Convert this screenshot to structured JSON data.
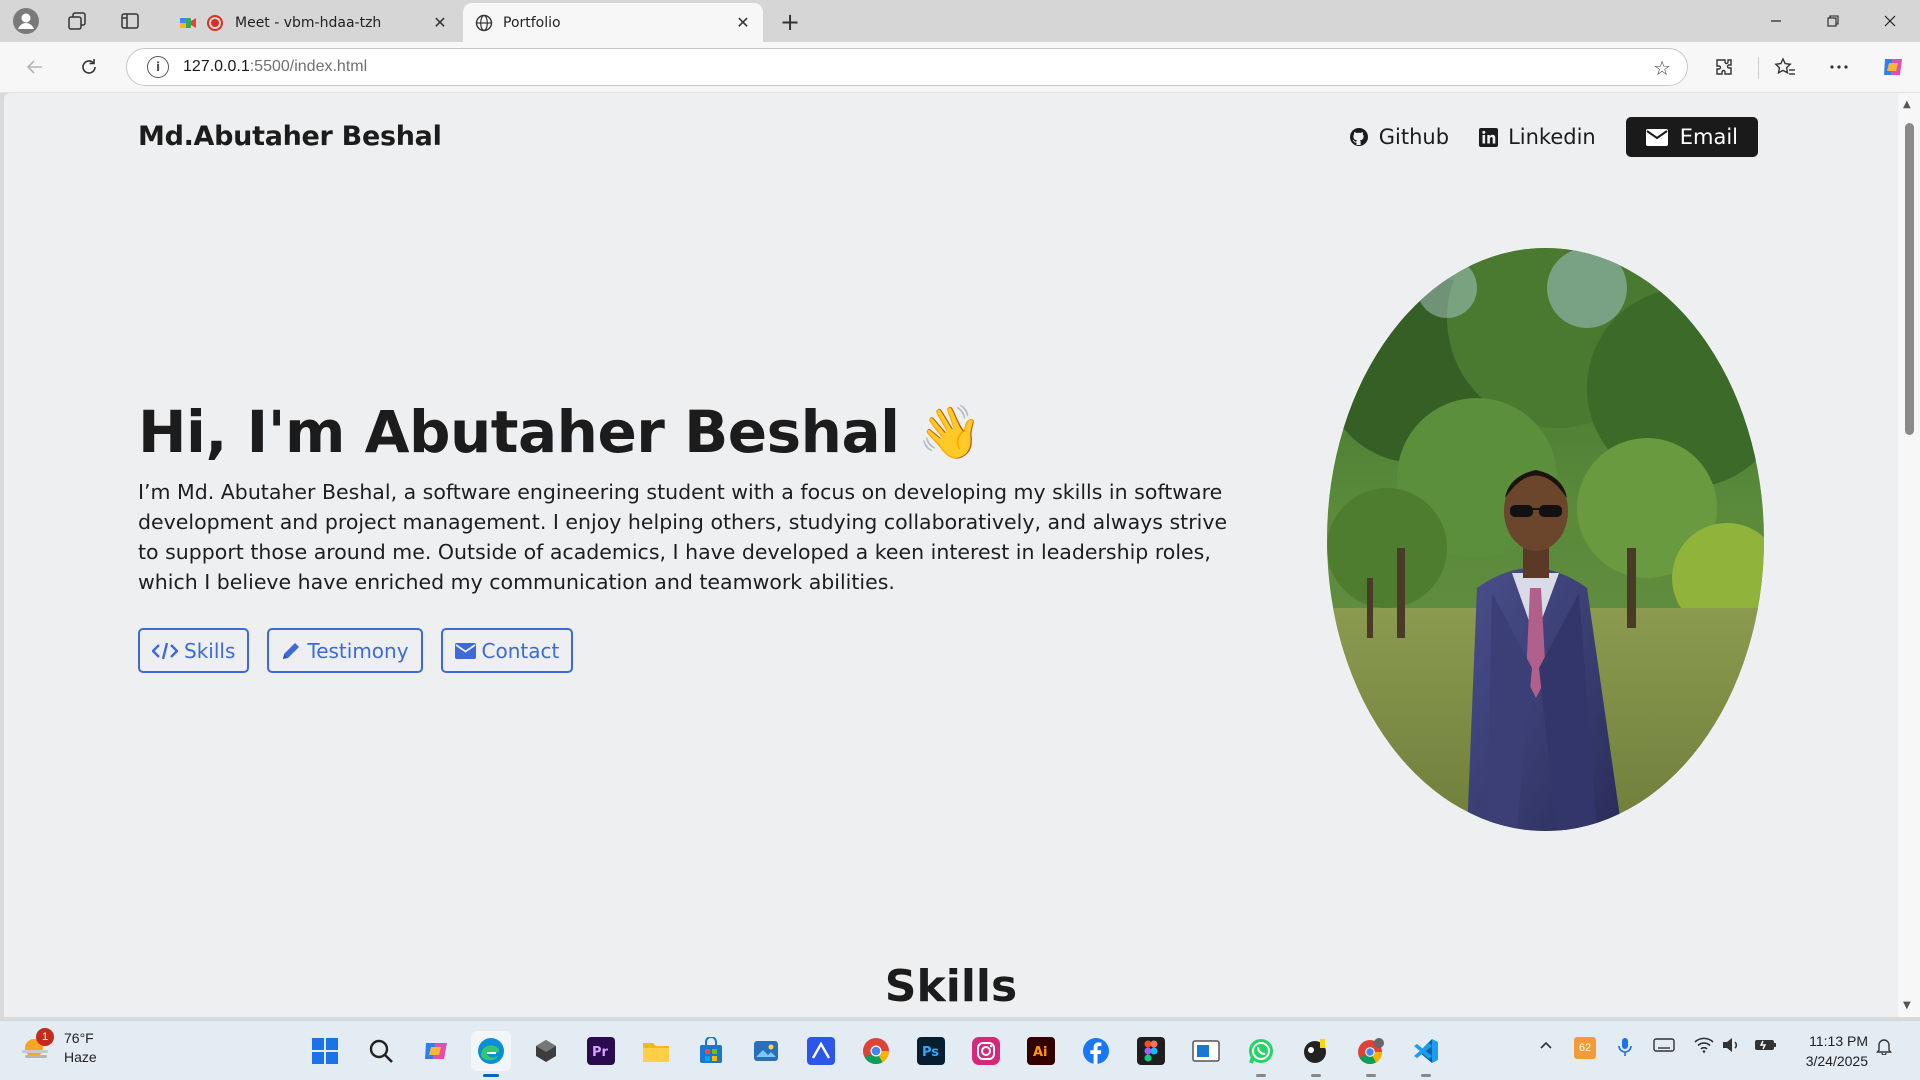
{
  "browser": {
    "tabs": [
      {
        "title": "Meet - vbm-hdaa-tzh",
        "active": false
      },
      {
        "title": "Portfolio",
        "active": true
      }
    ],
    "address": {
      "host": "127.0.0.1",
      "path": ":5500/index.html"
    }
  },
  "site": {
    "brand": "Md.Abutaher Beshal",
    "nav": {
      "github": "Github",
      "linkedin": "Linkedin",
      "email": "Email"
    },
    "hero": {
      "title": "Hi, I'm Abutaher Beshal",
      "wave": "👋",
      "text": "I’m Md. Abutaher Beshal, a software engineering student with a focus on developing my skills in software development and project management. I enjoy helping others, studying collaboratively, and always strive to support those around me. Outside of academics, I have developed a keen interest in leadership roles, which I believe have enriched my communication and teamwork abilities.",
      "buttons": {
        "skills": "Skills",
        "testimony": "Testimony",
        "contact": "Contact"
      }
    },
    "next_section_title": "Skills"
  },
  "taskbar": {
    "weather": {
      "temp": "76°F",
      "condition": "Haze",
      "badge": "1"
    },
    "tray_badge": "62",
    "clock": {
      "time": "11:13 PM",
      "date": "3/24/2025"
    }
  },
  "colors": {
    "accent": "#3d6ad6",
    "page_bg": "#eeeff1",
    "dark": "#1a1a1a"
  }
}
